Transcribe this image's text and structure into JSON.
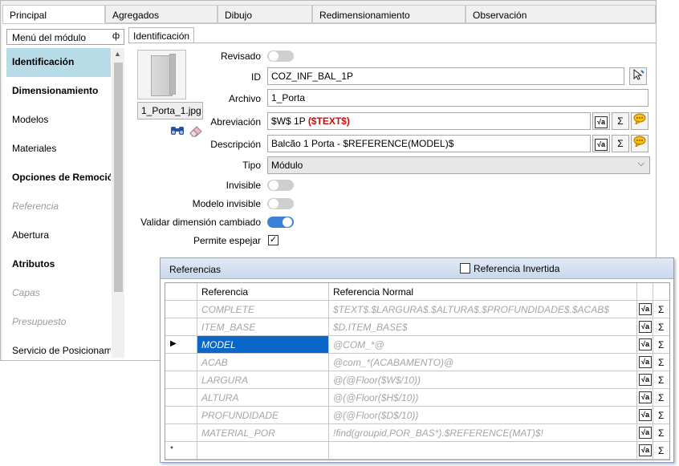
{
  "tabs": [
    "Principal",
    "Agregados",
    "Dibujo",
    "Redimensionamiento",
    "Observación"
  ],
  "sidebar": {
    "header": "Menú del módulo",
    "pin_glyph": "ф",
    "items": [
      {
        "label": "Identificación"
      },
      {
        "label": "Dimensionamiento"
      },
      {
        "label": "Modelos"
      },
      {
        "label": "Materiales"
      },
      {
        "label": "Opciones de Remoción"
      },
      {
        "label": "Referencia"
      },
      {
        "label": "Abertura"
      },
      {
        "label": "Atributos"
      },
      {
        "label": "Capas"
      },
      {
        "label": "Presupuesto"
      },
      {
        "label": "Servicio de Posicionamie"
      }
    ]
  },
  "subtab": "Identificación",
  "preview": {
    "filename": "1_Porta_1.jpg"
  },
  "form": {
    "revisado": {
      "label": "Revisado",
      "on": false
    },
    "id": {
      "label": "ID",
      "value": "COZ_INF_BAL_1P"
    },
    "archivo": {
      "label": "Archivo",
      "value": "1_Porta"
    },
    "abreviacion": {
      "label": "Abreviación",
      "value_part1": "$W$ 1P ",
      "value_part2": "($TEXT$)"
    },
    "descripcion": {
      "label": "Descripción",
      "value": "Balcão 1 Porta - $REFERENCE(MODEL)$"
    },
    "tipo": {
      "label": "Tipo",
      "value": "Módulo"
    },
    "invisible": {
      "label": "Invisible",
      "on": false
    },
    "modelo_invisible": {
      "label": "Modelo invisible",
      "on": false
    },
    "validar": {
      "label": "Validar dimensión cambiado",
      "on": true
    },
    "permite_espejar": {
      "label": "Permite espejar",
      "checked": true
    }
  },
  "icons": {
    "check": "✓",
    "sigma": "Σ",
    "sqrt": "√a",
    "chevron": "⌵",
    "up_arrow": "▲",
    "row_pointer": "▶",
    "new_row": "*"
  },
  "references": {
    "title": "Referencias",
    "invert_label": "Referencia Invertida",
    "columns": [
      "Referencia",
      "Referencia Normal"
    ],
    "rows": [
      {
        "ref": "COMPLETE",
        "normal": "$TEXT$.$LARGURA$.$ALTURA$.$PROFUNDIDADE$.$ACAB$"
      },
      {
        "ref": "ITEM_BASE",
        "normal": "$D.ITEM_BASE$"
      },
      {
        "ref": "MODEL",
        "normal": "@COM_*@"
      },
      {
        "ref": "ACAB",
        "normal": "@com_*(ACABAMENTO)@"
      },
      {
        "ref": "LARGURA",
        "normal": "@(@Floor($W$/10))"
      },
      {
        "ref": "ALTURA",
        "normal": "@(@Floor($H$/10))"
      },
      {
        "ref": "PROFUNDIDADE",
        "normal": "@(@Floor($D$/10))"
      },
      {
        "ref": "MATERIAL_POR",
        "normal": "!find(groupid,POR_BAS*).$REFERENCE(MAT)$!"
      }
    ]
  }
}
